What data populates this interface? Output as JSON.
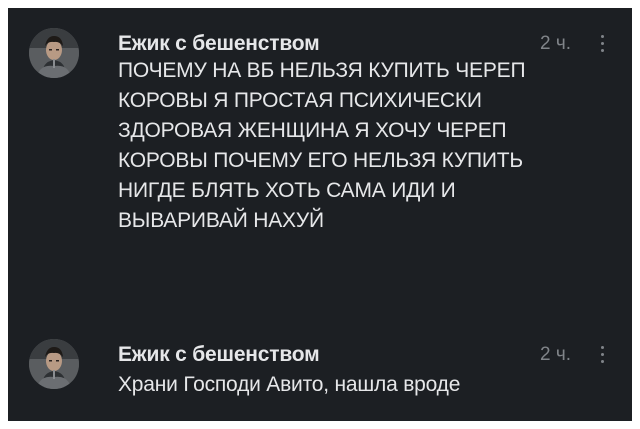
{
  "comments": [
    {
      "author": "Ежик с бешенством",
      "time": "2 ч.",
      "text": "ПОЧЕМУ НА ВБ НЕЛЬЗЯ КУПИТЬ ЧЕРЕП\nКОРОВЫ Я ПРОСТАЯ ПСИХИЧЕСКИ\nЗДОРОВАЯ ЖЕНЩИНА Я ХОЧУ ЧЕРЕП\nКОРОВЫ ПОЧЕМУ ЕГО НЕЛЬЗЯ КУПИТЬ\nНИГДЕ БЛЯТЬ ХОТЬ САМА ИДИ И\nВЫВАРИВАЙ НАХУЙ"
    },
    {
      "author": "Ежик с бешенством",
      "time": "2 ч.",
      "text": "Храни Господи Авито, нашла вроде"
    }
  ],
  "colors": {
    "background": "#1c1f23",
    "text": "#e6e7e9",
    "muted": "#808489"
  },
  "icons": {
    "menu": "more-vertical-icon"
  }
}
